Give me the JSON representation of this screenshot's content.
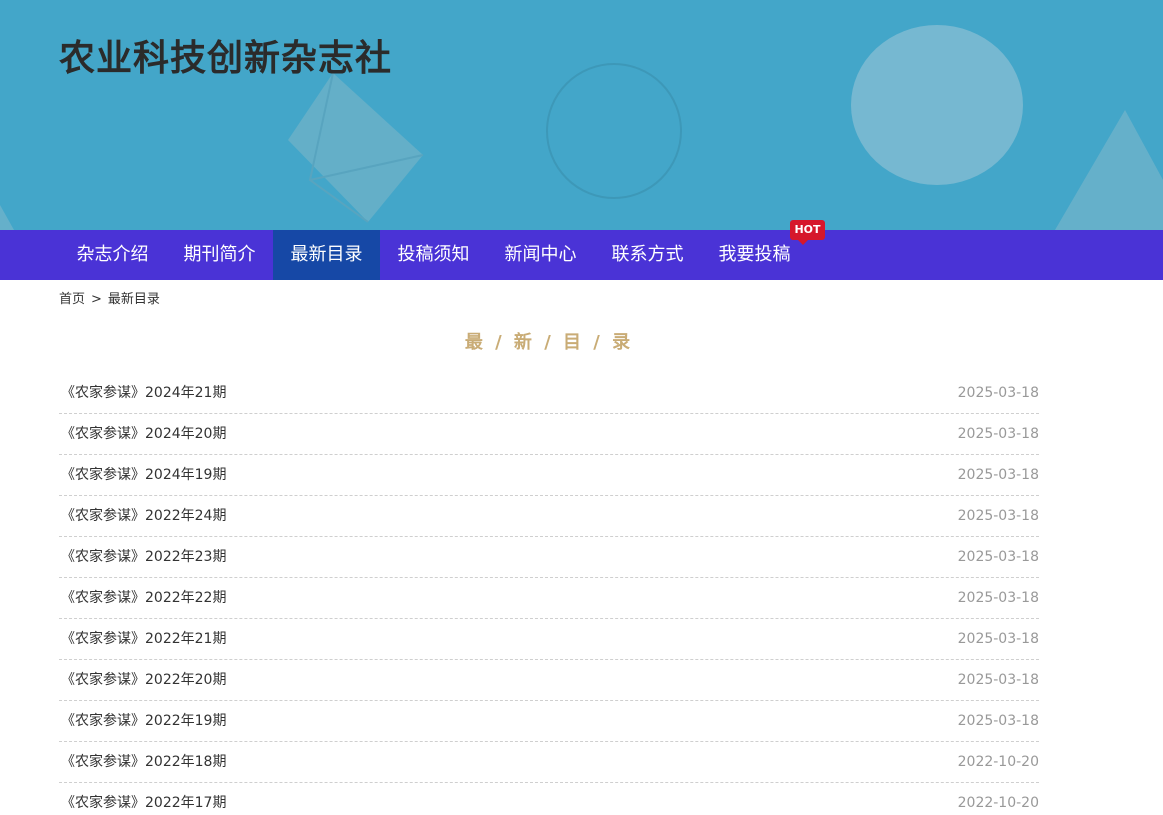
{
  "site": {
    "title": "农业科技创新杂志社"
  },
  "nav": {
    "items": [
      {
        "label": "杂志介绍"
      },
      {
        "label": "期刊简介"
      },
      {
        "label": "最新目录"
      },
      {
        "label": "投稿须知"
      },
      {
        "label": "新闻中心"
      },
      {
        "label": "联系方式"
      },
      {
        "label": "我要投稿"
      }
    ],
    "active_index": 2,
    "hot_badge": "HOT"
  },
  "breadcrumb": {
    "home": "首页",
    "separator": ">",
    "current": "最新目录"
  },
  "section": {
    "title": "最 / 新 / 目 / 录"
  },
  "list": {
    "items": [
      {
        "title": "《农家参谋》2024年21期",
        "date": "2025-03-18"
      },
      {
        "title": "《农家参谋》2024年20期",
        "date": "2025-03-18"
      },
      {
        "title": "《农家参谋》2024年19期",
        "date": "2025-03-18"
      },
      {
        "title": "《农家参谋》2022年24期",
        "date": "2025-03-18"
      },
      {
        "title": "《农家参谋》2022年23期",
        "date": "2025-03-18"
      },
      {
        "title": "《农家参谋》2022年22期",
        "date": "2025-03-18"
      },
      {
        "title": "《农家参谋》2022年21期",
        "date": "2025-03-18"
      },
      {
        "title": "《农家参谋》2022年20期",
        "date": "2025-03-18"
      },
      {
        "title": "《农家参谋》2022年19期",
        "date": "2025-03-18"
      },
      {
        "title": "《农家参谋》2022年18期",
        "date": "2022-10-20"
      },
      {
        "title": "《农家参谋》2022年17期",
        "date": "2022-10-20"
      }
    ]
  },
  "colors": {
    "banner": "#43a6c9",
    "nav": "#4a33d6",
    "nav_active": "#1648a6",
    "hot": "#d6172b",
    "section_title": "#c9ac76"
  }
}
